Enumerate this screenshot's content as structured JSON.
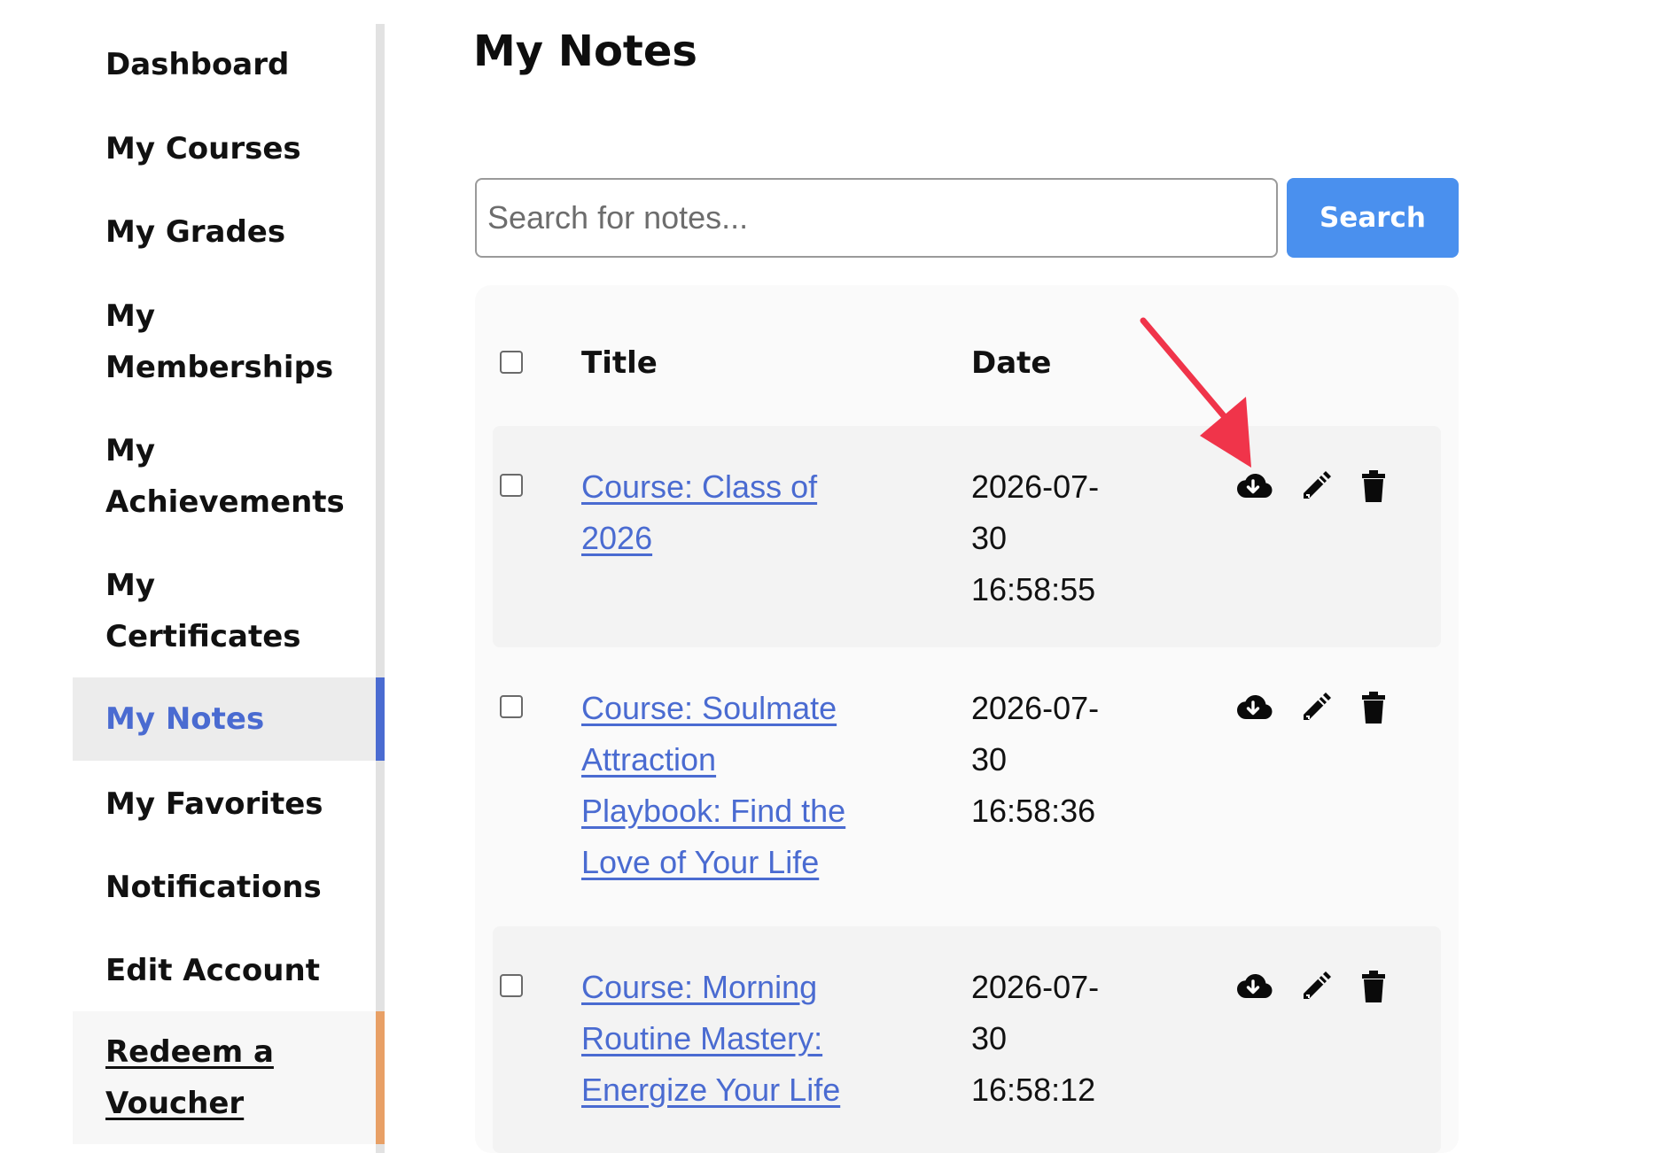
{
  "page": {
    "title": "My Notes"
  },
  "sidebar": {
    "items": [
      {
        "label": "Dashboard"
      },
      {
        "label": "My Courses"
      },
      {
        "label": "My Grades"
      },
      {
        "label_line1": "My",
        "label_line2": "Memberships"
      },
      {
        "label_line1": "My",
        "label_line2": "Achievements"
      },
      {
        "label_line1": "My",
        "label_line2": "Certificates"
      },
      {
        "label": "My Notes",
        "active": true
      },
      {
        "label": "My Favorites"
      },
      {
        "label": "Notifications"
      },
      {
        "label": "Edit Account"
      },
      {
        "label_line1": "Redeem a",
        "label_line2": "Voucher"
      }
    ],
    "active_color": "#4a6bd1",
    "voucher_accent": "#e8a066"
  },
  "search": {
    "placeholder": "Search for notes...",
    "value": "",
    "button_label": "Search",
    "button_color": "#4a90ee"
  },
  "table": {
    "columns": {
      "title": "Title",
      "date": "Date"
    },
    "rows": [
      {
        "title_lines": [
          "Course: Class of",
          "2026"
        ],
        "date_lines": [
          "2026-07-",
          "30",
          "16:58:55"
        ],
        "actions": [
          "cloud-download-icon",
          "pencil-icon",
          "trash-icon"
        ]
      },
      {
        "title_lines": [
          "Course: Soulmate",
          "Attraction",
          "Playbook: Find the",
          "Love of Your Life"
        ],
        "date_lines": [
          "2026-07-",
          "30",
          "16:58:36"
        ],
        "actions": [
          "cloud-download-icon",
          "pencil-icon",
          "trash-icon"
        ]
      },
      {
        "title_lines": [
          "Course: Morning",
          "Routine Mastery:",
          "Energize Your Life"
        ],
        "date_lines": [
          "2026-07-",
          "30",
          "16:58:12"
        ],
        "actions": [
          "cloud-download-icon",
          "pencil-icon",
          "trash-icon"
        ]
      }
    ]
  },
  "annotation": {
    "type": "arrow",
    "color": "#f0344a",
    "points_to": "cloud-download-icon"
  }
}
